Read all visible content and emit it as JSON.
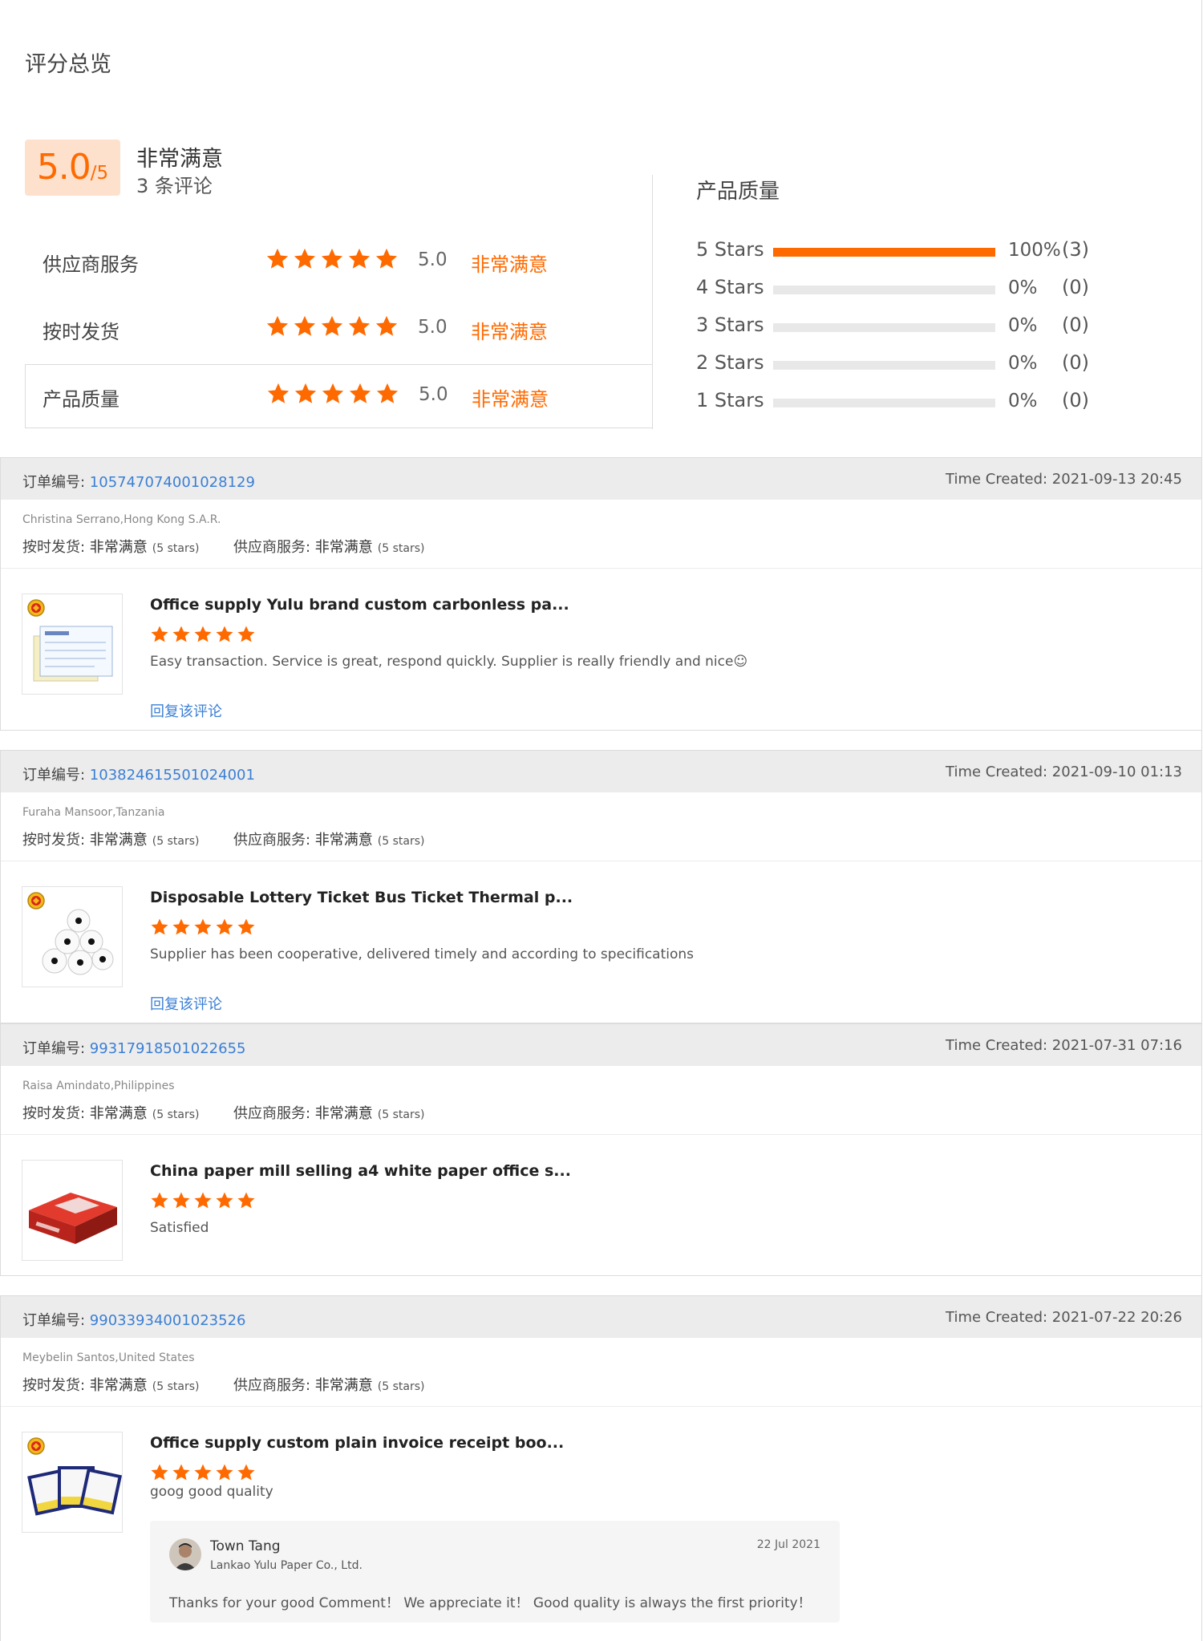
{
  "overview": {
    "title": "评分总览",
    "score_main": "5.0",
    "score_out_of": "/5",
    "score_label": "非常满意",
    "review_count": "3 条评论",
    "metrics": [
      {
        "name": "供应商服务",
        "value": "5.0",
        "text": "非常满意",
        "stars": 5
      },
      {
        "name": "按时发货",
        "value": "5.0",
        "text": "非常满意",
        "stars": 5
      },
      {
        "name": "产品质量",
        "value": "5.0",
        "text": "非常满意",
        "stars": 5
      }
    ],
    "product_quality": {
      "title": "产品质量",
      "rows": [
        {
          "label": "5  Stars",
          "fraction": 1.0,
          "pct": "100%",
          "count": "(3)"
        },
        {
          "label": "4  Stars",
          "fraction": 0.0,
          "pct": "0%",
          "count": "(0)"
        },
        {
          "label": "3  Stars",
          "fraction": 0.0,
          "pct": "0%",
          "count": "(0)"
        },
        {
          "label": "2  Stars",
          "fraction": 0.0,
          "pct": "0%",
          "count": "(0)"
        },
        {
          "label": "1  Stars",
          "fraction": 0.0,
          "pct": "0%",
          "count": "(0)"
        }
      ]
    }
  },
  "colors": {
    "accent": "#ff6a00",
    "link": "#3a7fd5",
    "track": "#e8e8e8",
    "header_bg": "#ececec"
  },
  "reviews": [
    {
      "order_label": "订单编号: ",
      "order_no": "105747074001028129",
      "time_created": "Time Created: 2021-09-13 20:45",
      "buyer": "Christina Serrano,Hong Kong S.A.R.",
      "delivery_label": "按时发货: ",
      "delivery_value": "非常满意",
      "delivery_stars": "(5 stars)",
      "service_label": "供应商服务: ",
      "service_value": "非常满意",
      "service_stars": "(5 stars)",
      "product_title": "Office supply Yulu brand custom carbonless pa...",
      "rating": 5,
      "comment": "Easy transaction. Service is great, respond quickly. Supplier is really friendly and nice☺",
      "reply_link": "回复该评论",
      "thumb_icon": "receipt-book-image",
      "has_medal": true
    },
    {
      "order_label": "订单编号: ",
      "order_no": "103824615501024001",
      "time_created": "Time Created: 2021-09-10 01:13",
      "buyer": "Furaha Mansoor,Tanzania",
      "delivery_label": "按时发货: ",
      "delivery_value": "非常满意",
      "delivery_stars": "(5 stars)",
      "service_label": "供应商服务: ",
      "service_value": "非常满意",
      "service_stars": "(5 stars)",
      "product_title": "Disposable Lottery Ticket Bus Ticket Thermal p...",
      "rating": 5,
      "comment": "Supplier has been cooperative, delivered timely and according to specifications",
      "reply_link": "回复该评论",
      "thumb_icon": "thermal-paper-rolls-image",
      "has_medal": true
    },
    {
      "order_label": "订单编号: ",
      "order_no": "99317918501022655",
      "time_created": "Time Created: 2021-07-31 07:16",
      "buyer": "Raisa Amindato,Philippines",
      "delivery_label": "按时发货: ",
      "delivery_value": "非常满意",
      "delivery_stars": "(5 stars)",
      "service_label": "供应商服务: ",
      "service_value": "非常满意",
      "service_stars": "(5 stars)",
      "product_title": "China paper mill selling a4 white paper office s...",
      "rating": 5,
      "comment": "Satisfied",
      "thumb_icon": "a4-paper-ream-image",
      "has_medal": false
    },
    {
      "order_label": "订单编号: ",
      "order_no": "99033934001023526",
      "time_created": "Time Created: 2021-07-22 20:26",
      "buyer": "Meybelin Santos,United States",
      "delivery_label": "按时发货: ",
      "delivery_value": "非常满意",
      "delivery_stars": "(5 stars)",
      "service_label": "供应商服务: ",
      "service_value": "非常满意",
      "service_stars": "(5 stars)",
      "product_title": "Office supply custom plain invoice receipt boo...",
      "rating": 5,
      "comment": "goog good quality",
      "thumb_icon": "invoice-books-image",
      "has_medal": true,
      "seller_reply": {
        "name": "Town Tang",
        "company": "Lankao Yulu Paper Co., Ltd.",
        "date": "22 Jul 2021",
        "text": "Thanks for your good Comment！ We appreciate it！ Good quality is always the first priority！"
      }
    }
  ]
}
